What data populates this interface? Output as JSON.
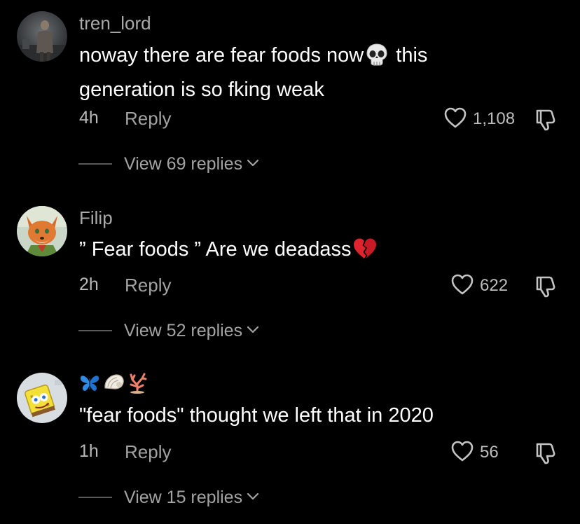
{
  "colors": {
    "background": "#000000",
    "username": "#a9a9a9",
    "text": "#ffffff",
    "meta": "#a3a3a3",
    "divider": "#5a5a5a"
  },
  "comments": [
    {
      "username": "tren_lord",
      "avatar_icon": "person-photo-avatar",
      "text_before_emoji": "noway there are fear foods now",
      "emoji_icon": "skull-emoji",
      "text_after_emoji": " this generation is so fking weak",
      "time": "4h",
      "reply_label": "Reply",
      "likes": "1,108",
      "view_replies": "View 69 replies"
    },
    {
      "username": "Filip",
      "avatar_icon": "fox-cartoon-avatar",
      "text_before_emoji": "” Fear foods ” Are we deadass",
      "emoji_icon": "broken-heart-emoji",
      "text_after_emoji": "",
      "time": "2h",
      "reply_label": "Reply",
      "likes": "622",
      "view_replies": "View 52 replies"
    },
    {
      "username_emoji_icons": [
        "butterfly-emoji",
        "shell-emoji",
        "coral-emoji"
      ],
      "avatar_icon": "spongebob-avatar",
      "text": "\"fear foods\" thought we left that in 2020",
      "time": "1h",
      "reply_label": "Reply",
      "likes": "56",
      "view_replies": "View 15 replies"
    }
  ]
}
